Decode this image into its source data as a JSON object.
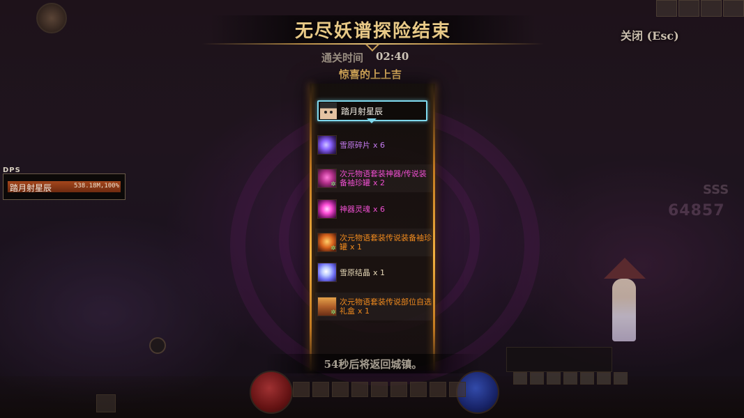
{
  "header": {
    "title": "无尽妖谱探险结束",
    "clear_time_label": "通关时间",
    "clear_time_value": "02:40",
    "luck_text": "惊喜的上上吉",
    "close_label": "关闭 (Esc)"
  },
  "player": {
    "name": "踏月射星辰"
  },
  "rewards": [
    {
      "name": "雪原碎片",
      "qty": "x 6",
      "icon": "purple-fragment-icon",
      "color": "#c67cf2"
    },
    {
      "name": "次元物语套装神器/传说装备袖珍罐",
      "qty": "x 2",
      "icon": "pink-jar-icon",
      "color": "#ee4fd0"
    },
    {
      "name": "神器灵魂",
      "qty": "x 6",
      "icon": "artifact-soul-icon",
      "color": "#ee4fd0"
    },
    {
      "name": "次元物语套装传说装备袖珍罐",
      "qty": "x 1",
      "icon": "orange-jar-icon",
      "color": "#f08a1e"
    },
    {
      "name": "雪原结晶",
      "qty": "x 1",
      "icon": "snow-crystal-icon",
      "color": "#e7d9b8"
    },
    {
      "name": "次元物语套装传说部位自选礼盒",
      "qty": "x 1",
      "icon": "gift-chest-icon",
      "color": "#f08a1e"
    }
  ],
  "footer": {
    "return_text": "54秒后将返回城镇。"
  },
  "dps": {
    "label": "DPS",
    "player_name": "踏月射星辰",
    "value_text": "538.18M,100%",
    "share_fraction": 1.0
  },
  "colors": {
    "title_gold": "#e8c987",
    "luck_gold": "#e7b760",
    "selection_cyan": "#7fd9ee",
    "column_glow": "#f1b040"
  }
}
